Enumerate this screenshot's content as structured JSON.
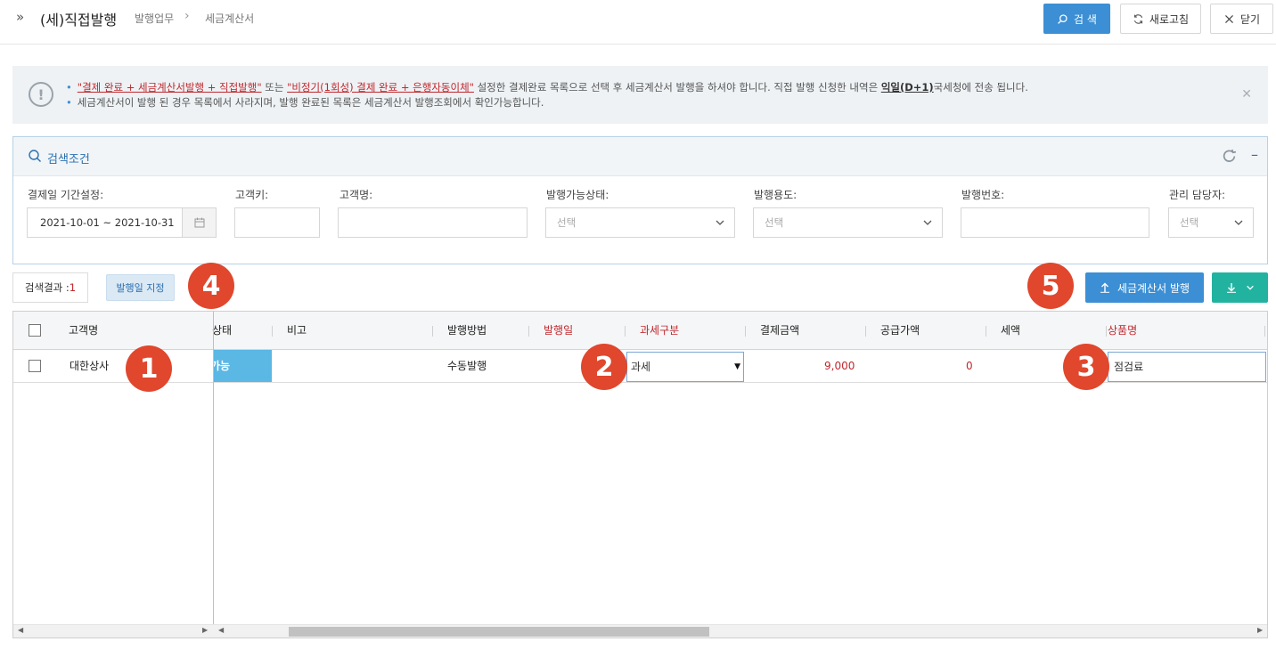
{
  "header": {
    "title": "(세)직접발행",
    "breadcrumb": [
      "발행업무",
      "세금계산서"
    ],
    "buttons": {
      "search": "검 색",
      "refresh": "새로고침",
      "close": "닫기"
    }
  },
  "notice": {
    "line1_red1": "\"결제 완료 + 세금계산서발행 + 직접발행\"",
    "line1_mid": " 또는 ",
    "line1_red2": "\"비정기(1회성) 결제 완료 + 은행자동이체\"",
    "line1_rest": " 설정한 결제완료 목록으로 선택 후 세금계산서 발행을 하셔야 합니다. 직접 발행 신청한 내역은 ",
    "line1_strong": "익일(D+1)",
    "line1_end": "국세청에 전송 됩니다.",
    "line2": "세금계산서이 발행 된 경우 목록에서 사라지며, 발행 완료된 목록은 세금계산서 발행조회에서 확인가능합니다."
  },
  "search_panel": {
    "title": "검색조건",
    "fields": {
      "period_label": "결제일 기간설정:",
      "period_value": "2021-10-01 ~ 2021-10-31",
      "customer_key_label": "고객키:",
      "customer_name_label": "고객명:",
      "status_label": "발행가능상태:",
      "status_value": "선택",
      "purpose_label": "발행용도:",
      "purpose_value": "선택",
      "number_label": "발행번호:",
      "manager_label": "관리 담당자:",
      "manager_value": "선택"
    }
  },
  "results": {
    "count_label": "검색결과 : ",
    "count_value": "1",
    "set_date_button": "발행일 지정",
    "issue_button": "세금계산서 발행"
  },
  "markers": [
    "1",
    "2",
    "3",
    "4",
    "5"
  ],
  "grid": {
    "headers": {
      "customer": "고객명",
      "status": "상태",
      "note": "비고",
      "method": "발행방법",
      "issue_date": "발행일",
      "tax_type": "과세구분",
      "payment_amount": "결제금액",
      "supply_amount": "공급가액",
      "tax": "세액",
      "product": "상품명"
    },
    "rows": [
      {
        "customer": "대한상사",
        "status": "가능",
        "note": "",
        "method": "수동발행",
        "issue_date": "",
        "tax_type": "과세",
        "payment_amount": "9,000",
        "supply_amount": "0",
        "tax": "",
        "product": "점검료"
      }
    ]
  },
  "colors": {
    "primary": "#3c8fd4",
    "teal": "#22b3a0",
    "required": "#c0282d",
    "marker": "#e0472d",
    "status_fill": "#5bb7e3"
  }
}
